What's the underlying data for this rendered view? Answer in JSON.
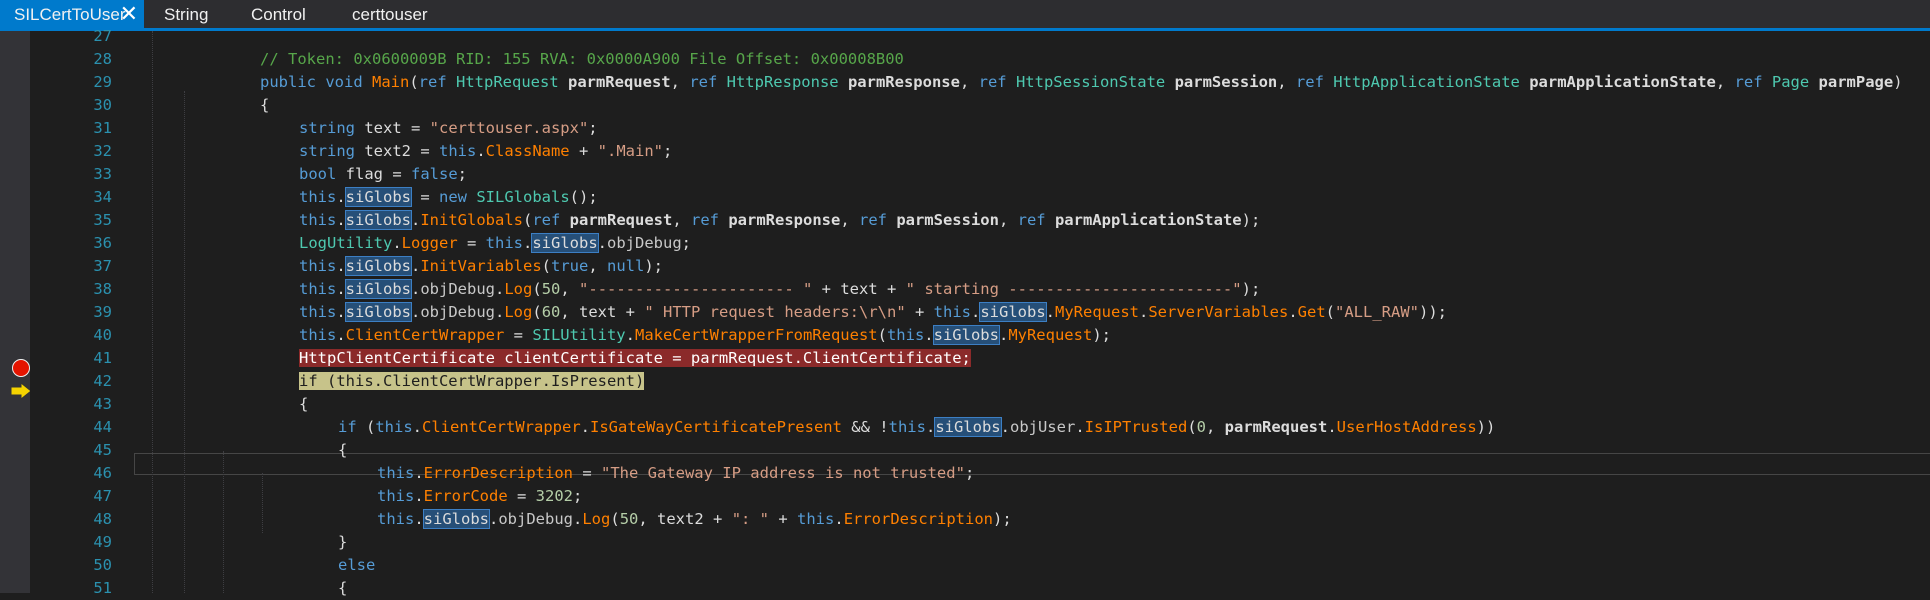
{
  "tabs": [
    {
      "label": "SILCertToUser",
      "active": true
    },
    {
      "label": "String"
    },
    {
      "label": "Control"
    },
    {
      "label": "certtouser"
    }
  ],
  "lines": [
    {
      "n": "27",
      "indent": 1,
      "tokens": []
    },
    {
      "n": "28",
      "indent": 2,
      "tokens": [
        [
          "cm",
          "// Token: 0x0600009B RID: 155 RVA: 0x0000A900 File Offset: 0x00008B00"
        ]
      ]
    },
    {
      "n": "29",
      "indent": 2,
      "tokens": [
        [
          "kw",
          "public "
        ],
        [
          "kw",
          "void "
        ],
        [
          "fn",
          "Main"
        ],
        [
          "pp",
          "("
        ],
        [
          "kw",
          "ref "
        ],
        [
          "ty",
          "HttpRequest "
        ],
        [
          "pr",
          "parmRequest"
        ],
        [
          "pp",
          ", "
        ],
        [
          "kw",
          "ref "
        ],
        [
          "ty",
          "HttpResponse "
        ],
        [
          "pr",
          "parmResponse"
        ],
        [
          "pp",
          ", "
        ],
        [
          "kw",
          "ref "
        ],
        [
          "ty",
          "HttpSessionState "
        ],
        [
          "pr",
          "parmSession"
        ],
        [
          "pp",
          ", "
        ],
        [
          "kw",
          "ref "
        ],
        [
          "ty",
          "HttpApplicationState "
        ],
        [
          "pr",
          "parmApplicationState"
        ],
        [
          "pp",
          ", "
        ],
        [
          "kw",
          "ref "
        ],
        [
          "ty",
          "Page "
        ],
        [
          "pr",
          "parmPage"
        ],
        [
          "pp",
          ")"
        ]
      ]
    },
    {
      "n": "30",
      "indent": 2,
      "tokens": [
        [
          "pp",
          "{"
        ]
      ]
    },
    {
      "n": "31",
      "indent": 3,
      "tokens": [
        [
          "kw",
          "string "
        ],
        [
          "pp",
          "text = "
        ],
        [
          "st",
          "\"certtouser.aspx\""
        ],
        [
          "pp",
          ";"
        ]
      ]
    },
    {
      "n": "32",
      "indent": 3,
      "tokens": [
        [
          "kw",
          "string "
        ],
        [
          "pp",
          "text2 = "
        ],
        [
          "kw",
          "this"
        ],
        [
          "pp",
          "."
        ],
        [
          "fn",
          "ClassName"
        ],
        [
          "pp",
          " + "
        ],
        [
          "st",
          "\".Main\""
        ],
        [
          "pp",
          ";"
        ]
      ]
    },
    {
      "n": "33",
      "indent": 3,
      "tokens": [
        [
          "kw",
          "bool "
        ],
        [
          "pp",
          "flag = "
        ],
        [
          "kw",
          "false"
        ],
        [
          "pp",
          ";"
        ]
      ]
    },
    {
      "n": "34",
      "indent": 3,
      "tokens": [
        [
          "kw",
          "this"
        ],
        [
          "pp",
          "."
        ],
        [
          "hl",
          "siGlobs"
        ],
        [
          "pp",
          " = "
        ],
        [
          "kw",
          "new "
        ],
        [
          "ty",
          "SILGlobals"
        ],
        [
          "pp",
          "();"
        ]
      ]
    },
    {
      "n": "35",
      "indent": 3,
      "tokens": [
        [
          "kw",
          "this"
        ],
        [
          "pp",
          "."
        ],
        [
          "hl",
          "siGlobs"
        ],
        [
          "pp",
          "."
        ],
        [
          "fn",
          "InitGlobals"
        ],
        [
          "pp",
          "("
        ],
        [
          "kw",
          "ref "
        ],
        [
          "pr",
          "parmRequest"
        ],
        [
          "pp",
          ", "
        ],
        [
          "kw",
          "ref "
        ],
        [
          "pr",
          "parmResponse"
        ],
        [
          "pp",
          ", "
        ],
        [
          "kw",
          "ref "
        ],
        [
          "pr",
          "parmSession"
        ],
        [
          "pp",
          ", "
        ],
        [
          "kw",
          "ref "
        ],
        [
          "pr",
          "parmApplicationState"
        ],
        [
          "pp",
          ");"
        ]
      ]
    },
    {
      "n": "36",
      "indent": 3,
      "tokens": [
        [
          "ty",
          "LogUtility"
        ],
        [
          "pp",
          "."
        ],
        [
          "fn",
          "Logger"
        ],
        [
          "pp",
          " = "
        ],
        [
          "kw",
          "this"
        ],
        [
          "pp",
          "."
        ],
        [
          "hl",
          "siGlobs"
        ],
        [
          "pp",
          "."
        ],
        [
          "mb",
          "objDebug"
        ],
        [
          "pp",
          ";"
        ]
      ]
    },
    {
      "n": "37",
      "indent": 3,
      "tokens": [
        [
          "kw",
          "this"
        ],
        [
          "pp",
          "."
        ],
        [
          "hl",
          "siGlobs"
        ],
        [
          "pp",
          "."
        ],
        [
          "fn",
          "InitVariables"
        ],
        [
          "pp",
          "("
        ],
        [
          "kw",
          "true"
        ],
        [
          "pp",
          ", "
        ],
        [
          "kw",
          "null"
        ],
        [
          "pp",
          ");"
        ]
      ]
    },
    {
      "n": "38",
      "indent": 3,
      "tokens": [
        [
          "kw",
          "this"
        ],
        [
          "pp",
          "."
        ],
        [
          "hl",
          "siGlobs"
        ],
        [
          "pp",
          "."
        ],
        [
          "mb",
          "objDebug"
        ],
        [
          "pp",
          "."
        ],
        [
          "fn",
          "Log"
        ],
        [
          "pp",
          "("
        ],
        [
          "nm",
          "50"
        ],
        [
          "pp",
          ", "
        ],
        [
          "st",
          "\"---------------------- \""
        ],
        [
          "pp",
          " + text + "
        ],
        [
          "st",
          "\" starting ------------------------\""
        ],
        [
          "pp",
          ");"
        ]
      ]
    },
    {
      "n": "39",
      "indent": 3,
      "tokens": [
        [
          "kw",
          "this"
        ],
        [
          "pp",
          "."
        ],
        [
          "hl",
          "siGlobs"
        ],
        [
          "pp",
          "."
        ],
        [
          "mb",
          "objDebug"
        ],
        [
          "pp",
          "."
        ],
        [
          "fn",
          "Log"
        ],
        [
          "pp",
          "("
        ],
        [
          "nm",
          "60"
        ],
        [
          "pp",
          ", text + "
        ],
        [
          "st",
          "\" HTTP request headers:\\r\\n\""
        ],
        [
          "pp",
          " + "
        ],
        [
          "kw",
          "this"
        ],
        [
          "pp",
          "."
        ],
        [
          "hl",
          "siGlobs"
        ],
        [
          "pp",
          "."
        ],
        [
          "fn",
          "MyRequest"
        ],
        [
          "pp",
          "."
        ],
        [
          "fn",
          "ServerVariables"
        ],
        [
          "pp",
          "."
        ],
        [
          "fn",
          "Get"
        ],
        [
          "pp",
          "("
        ],
        [
          "st",
          "\"ALL_RAW\""
        ],
        [
          "pp",
          "));"
        ]
      ]
    },
    {
      "n": "40",
      "indent": 3,
      "tokens": [
        [
          "kw",
          "this"
        ],
        [
          "pp",
          "."
        ],
        [
          "fn",
          "ClientCertWrapper"
        ],
        [
          "pp",
          " = "
        ],
        [
          "ty",
          "SILUtility"
        ],
        [
          "pp",
          "."
        ],
        [
          "fn",
          "MakeCertWrapperFromRequest"
        ],
        [
          "pp",
          "("
        ],
        [
          "kw",
          "this"
        ],
        [
          "pp",
          "."
        ],
        [
          "hl",
          "siGlobs"
        ],
        [
          "pp",
          "."
        ],
        [
          "fn",
          "MyRequest"
        ],
        [
          "pp",
          ");"
        ]
      ]
    },
    {
      "n": "41",
      "indent": 3,
      "mark": "breakpoint",
      "text": "HttpClientCertificate clientCertificate = parmRequest.ClientCertificate;",
      "tokens": []
    },
    {
      "n": "42",
      "indent": 3,
      "mark": "current",
      "text": "if (this.ClientCertWrapper.IsPresent)",
      "tokens": []
    },
    {
      "n": "43",
      "indent": 3,
      "tokens": [
        [
          "pp",
          "{"
        ]
      ]
    },
    {
      "n": "44",
      "indent": 4,
      "tokens": [
        [
          "kw",
          "if "
        ],
        [
          "pp",
          "("
        ],
        [
          "kw",
          "this"
        ],
        [
          "pp",
          "."
        ],
        [
          "fn",
          "ClientCertWrapper"
        ],
        [
          "pp",
          "."
        ],
        [
          "fn",
          "IsGateWayCertificatePresent"
        ],
        [
          "pp",
          " && !"
        ],
        [
          "kw",
          "this"
        ],
        [
          "pp",
          "."
        ],
        [
          "hl",
          "siGlobs"
        ],
        [
          "pp",
          "."
        ],
        [
          "mb",
          "objUser"
        ],
        [
          "pp",
          "."
        ],
        [
          "fn",
          "IsIPTrusted"
        ],
        [
          "pp",
          "("
        ],
        [
          "nm",
          "0"
        ],
        [
          "pp",
          ", "
        ],
        [
          "pr",
          "parmRequest"
        ],
        [
          "pp",
          "."
        ],
        [
          "fn",
          "UserHostAddress"
        ],
        [
          "pp",
          "))"
        ]
      ]
    },
    {
      "n": "45",
      "indent": 4,
      "tokens": [
        [
          "pp",
          "{"
        ]
      ]
    },
    {
      "n": "46",
      "indent": 5,
      "tokens": [
        [
          "kw",
          "this"
        ],
        [
          "pp",
          "."
        ],
        [
          "fn",
          "ErrorDescription"
        ],
        [
          "pp",
          " = "
        ],
        [
          "st",
          "\"The Gateway IP address is not trusted\""
        ],
        [
          "pp",
          ";"
        ]
      ]
    },
    {
      "n": "47",
      "indent": 5,
      "tokens": [
        [
          "kw",
          "this"
        ],
        [
          "pp",
          "."
        ],
        [
          "fn",
          "ErrorCode"
        ],
        [
          "pp",
          " = "
        ],
        [
          "nm",
          "3202"
        ],
        [
          "pp",
          ";"
        ]
      ]
    },
    {
      "n": "48",
      "indent": 5,
      "tokens": [
        [
          "kw",
          "this"
        ],
        [
          "pp",
          "."
        ],
        [
          "hl",
          "siGlobs"
        ],
        [
          "pp",
          "."
        ],
        [
          "mb",
          "objDebug"
        ],
        [
          "pp",
          "."
        ],
        [
          "fn",
          "Log"
        ],
        [
          "pp",
          "("
        ],
        [
          "nm",
          "50"
        ],
        [
          "pp",
          ", text2 + "
        ],
        [
          "st",
          "\": \""
        ],
        [
          "pp",
          " + "
        ],
        [
          "kw",
          "this"
        ],
        [
          "pp",
          "."
        ],
        [
          "fn",
          "ErrorDescription"
        ],
        [
          "pp",
          ");"
        ]
      ]
    },
    {
      "n": "49",
      "indent": 4,
      "tokens": [
        [
          "pp",
          "}"
        ]
      ]
    },
    {
      "n": "50",
      "indent": 4,
      "tokens": [
        [
          "kw",
          "else"
        ]
      ]
    },
    {
      "n": "51",
      "indent": 4,
      "tokens": [
        [
          "pp",
          "{"
        ]
      ]
    }
  ]
}
